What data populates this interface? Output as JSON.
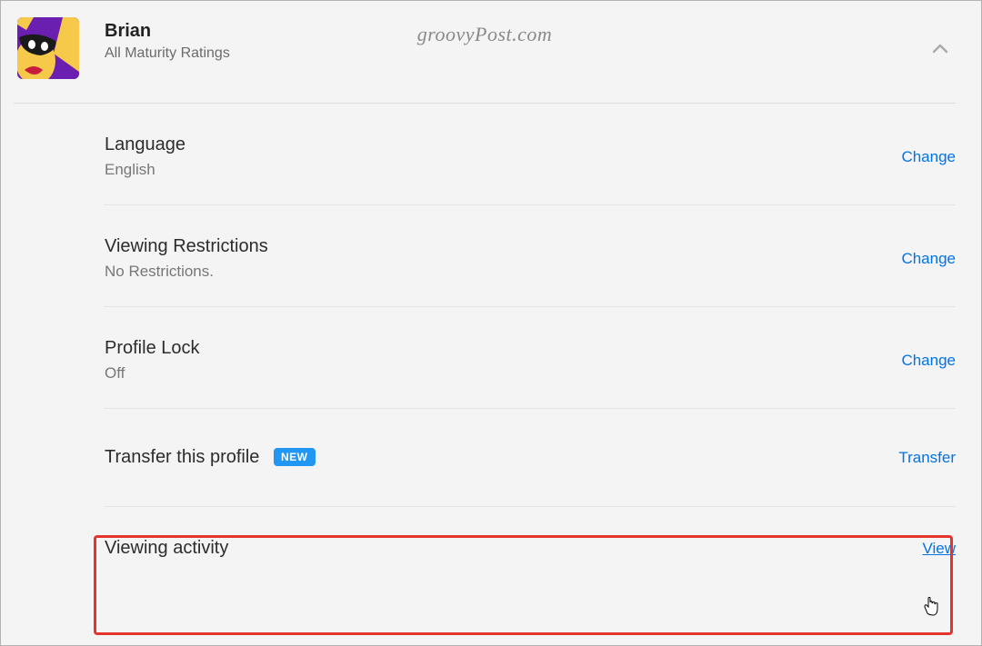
{
  "watermark": "groovyPost.com",
  "profile": {
    "name": "Brian",
    "maturity": "All Maturity Ratings"
  },
  "rows": {
    "language": {
      "title": "Language",
      "value": "English",
      "action": "Change"
    },
    "restrictions": {
      "title": "Viewing Restrictions",
      "value": "No Restrictions.",
      "action": "Change"
    },
    "lock": {
      "title": "Profile Lock",
      "value": "Off",
      "action": "Change"
    },
    "transfer": {
      "title": "Transfer this profile",
      "badge": "NEW",
      "action": "Transfer"
    },
    "activity": {
      "title": "Viewing activity",
      "action": "View"
    }
  }
}
